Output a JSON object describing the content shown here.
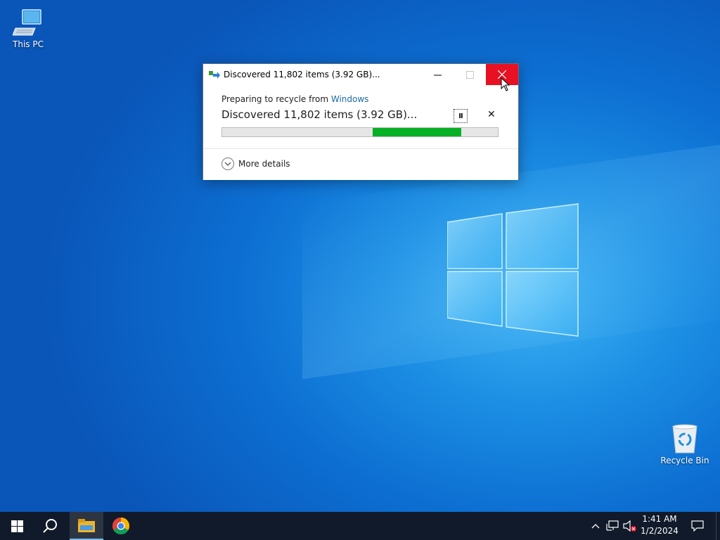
{
  "desktop": {
    "icons": [
      {
        "label": "This PC"
      },
      {
        "label": "Recycle Bin"
      }
    ]
  },
  "dialog": {
    "title": "Discovered 11,802 items (3.92 GB)...",
    "preparing_prefix": "Preparing to recycle from ",
    "source_link": "Windows",
    "status_text": "Discovered 11,802 items (3.92 GB)...",
    "progress_start_fraction": 0.545,
    "progress_end_fraction": 0.868,
    "more_details_label": "More details",
    "cancel_glyph": "✕",
    "pause_glyph": "II"
  },
  "taskbar": {
    "time": "1:41 AM",
    "date": "1/2/2024"
  },
  "colors": {
    "close_button": "#e81123",
    "progress_fill": "#06b025",
    "link": "#1a6aa6",
    "taskbar": "#101a2a"
  },
  "icons": [
    "windows-start-icon",
    "search-icon",
    "file-explorer-icon",
    "chrome-icon",
    "chevron-up-icon",
    "network-icon",
    "volume-muted-icon",
    "notifications-icon"
  ]
}
